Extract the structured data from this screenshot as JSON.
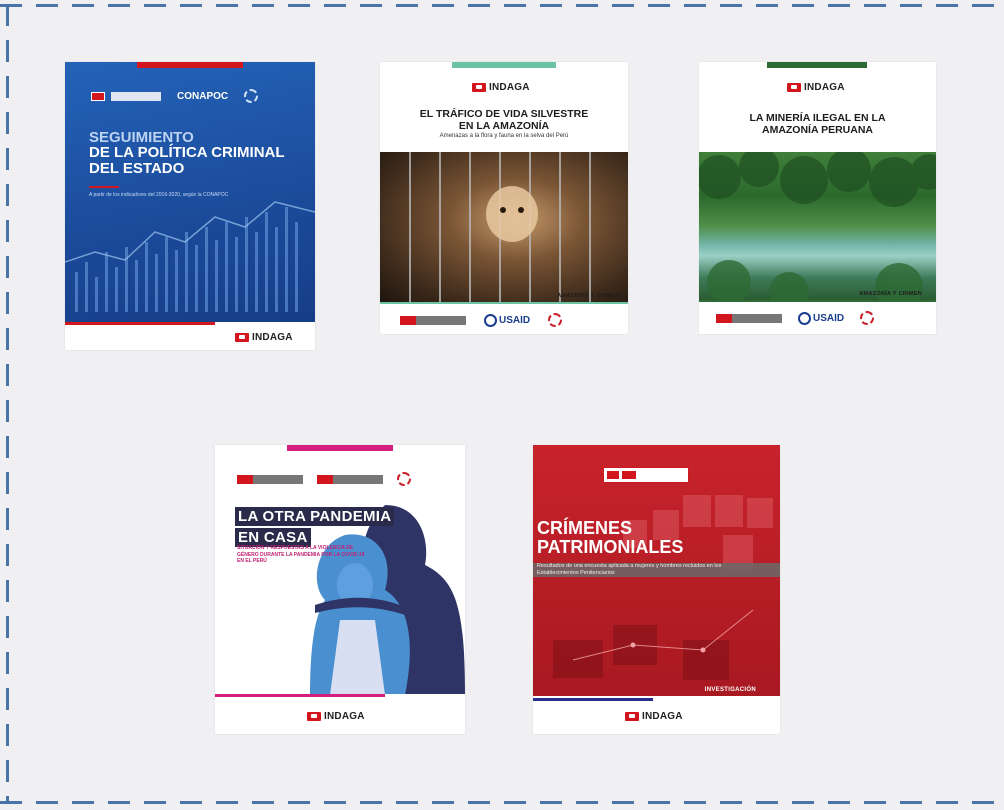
{
  "covers": [
    {
      "title_line1": "SEGUIMIENTO",
      "title_line2": "DE LA POLÍTICA CRIMINAL",
      "title_line3": "DEL ESTADO",
      "subtitle": "A partir de los indicadores del 2016-2020, según la CONAPOC",
      "partner": "CONAPOC",
      "publisher": "INDAGA"
    },
    {
      "publisher": "INDAGA",
      "title_line1": "EL TRÁFICO DE VIDA SILVESTRE",
      "title_line2": "EN LA AMAZONÍA",
      "subtitle": "Amenazas a la flora y fauna en la selva del Perú",
      "tag": "AMAZONÍA Y CRIMEN",
      "partner": "USAID"
    },
    {
      "publisher": "INDAGA",
      "title_line1": "LA MINERÍA ILEGAL EN LA",
      "title_line2": "AMAZONÍA PERUANA",
      "tag": "AMAZONÍA Y CRIMEN",
      "partner": "USAID"
    },
    {
      "title_line1": "LA OTRA PANDEMIA",
      "title_line2": "EN CASA",
      "subtitle": "SITUACIÓN Y RESPUESTAS A LA VIOLENCIA DE GÉNERO DURANTE LA PANDEMIA POR LA COVID-19 EN EL PERÚ",
      "publisher": "INDAGA"
    },
    {
      "title_line1": "CRÍMENES",
      "title_line2": "PATRIMONIALES",
      "subtitle": "Resultados de una encuesta aplicada a mujeres y hombres recluidos en los Establecimientos Penitenciarios",
      "tag": "INVESTIGACIÓN",
      "publisher": "INDAGA"
    }
  ],
  "colors": {
    "frame_dash": "#4a74a8",
    "background": "#f0f0f2",
    "peru_red": "#d3161d",
    "cover1_blue": "#1e4fa3",
    "cover2_green": "#6cc3a4",
    "cover3_green": "#2d6a36",
    "cover4_magenta": "#d3207e",
    "cover5_red": "#c8232c"
  }
}
